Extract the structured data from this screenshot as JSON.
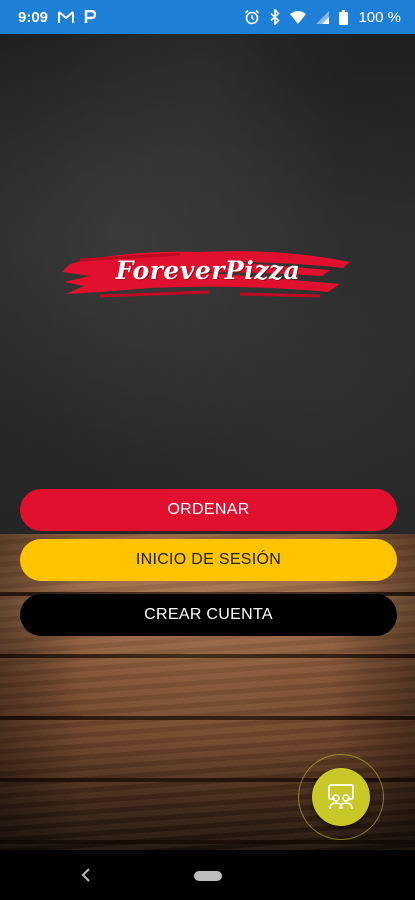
{
  "status_bar": {
    "time": "9:09",
    "left_icons": [
      "gmail-icon",
      "parking-icon"
    ],
    "right_icons": [
      "alarm-icon",
      "bluetooth-icon",
      "wifi-icon",
      "signal-icon",
      "battery-icon"
    ],
    "battery": "100 %",
    "background_color": "#1e7fd6"
  },
  "logo": {
    "text": "ForeverPizza",
    "brush_color": "#e0102e"
  },
  "buttons": {
    "order": {
      "label": "ORDENAR",
      "bg": "#e0102e",
      "color": "#ffffff"
    },
    "login": {
      "label": "INICIO DE SESIÓN",
      "bg": "#ffc300",
      "color": "#222222"
    },
    "create": {
      "label": "CREAR CUENTA",
      "bg": "#000000",
      "color": "#ffffff"
    }
  },
  "fab": {
    "icon": "chat-users-icon",
    "color": "#c8c828"
  },
  "nav_bar": {
    "icons": [
      "back-icon",
      "home-pill-icon"
    ]
  }
}
